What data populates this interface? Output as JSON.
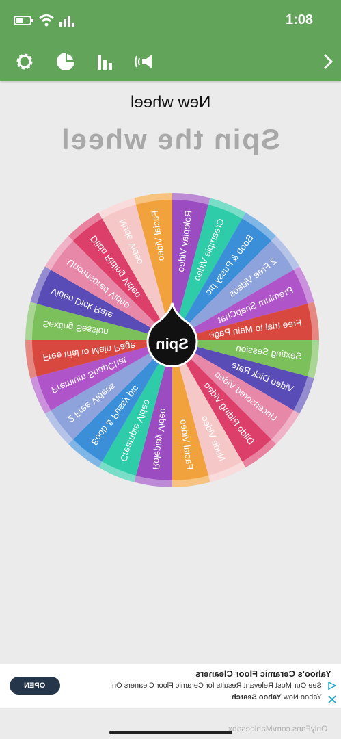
{
  "status_bar": {
    "time": "1:08",
    "icons": [
      "battery-icon",
      "wifi-icon",
      "signal-icon"
    ]
  },
  "toolbar": {
    "icons": [
      "gear-icon",
      "pie-chart-icon",
      "bar-chart-icon",
      "sound-icon",
      "chevron-right-icon"
    ]
  },
  "wheel": {
    "name": "New wheel",
    "heading": "Spin the wheel",
    "spin_label": "Spin",
    "segments": [
      "Roleplay Video",
      "Creampie Video",
      "Boob & Pussy pic",
      "2 Free Videos",
      "Premium SnapChat",
      "Free trial to Main Page",
      "Sexting Session",
      "Video Dick Rate",
      "Uncensored Video",
      "Dildo Riding Video",
      "Nude Video",
      "Facial Video",
      "Roleplay Video",
      "Creampie Video",
      "Boob & Pussy pic",
      "2 Free Videos",
      "Premium SnapChat",
      "Free trial to Main Page",
      "Sexting Session",
      "Video Dick Rate",
      "Uncensored Video",
      "Dildo Riding Video",
      "Nude Video",
      "Facial Video"
    ],
    "colors": [
      "#9a4cc0",
      "#2fcca9",
      "#3b8fd9",
      "#8ea2db",
      "#b055c9",
      "#d9483f",
      "#7cc05c",
      "#5a4cb7",
      "#e888a8",
      "#db3f6a",
      "#f6c7c7",
      "#f2a23c",
      "#9a4cc0",
      "#2fcca9",
      "#3b8fd9",
      "#8ea2db",
      "#b055c9",
      "#d9483f",
      "#7cc05c",
      "#5a4cb7",
      "#e888a8",
      "#db3f6a",
      "#f6c7c7",
      "#f2a23c"
    ]
  },
  "ad": {
    "title": "Yahoo's Ceramic Floor Cleaners",
    "line1": "See Our Most Relevant Results for Ceramic Floor Cleaners On",
    "line2_prefix": "Yahoo Now",
    "line2_brand": "Yahoo Search",
    "open_label": "OPEN"
  },
  "watermark": "OnlyFans.com/Mahleesahx"
}
